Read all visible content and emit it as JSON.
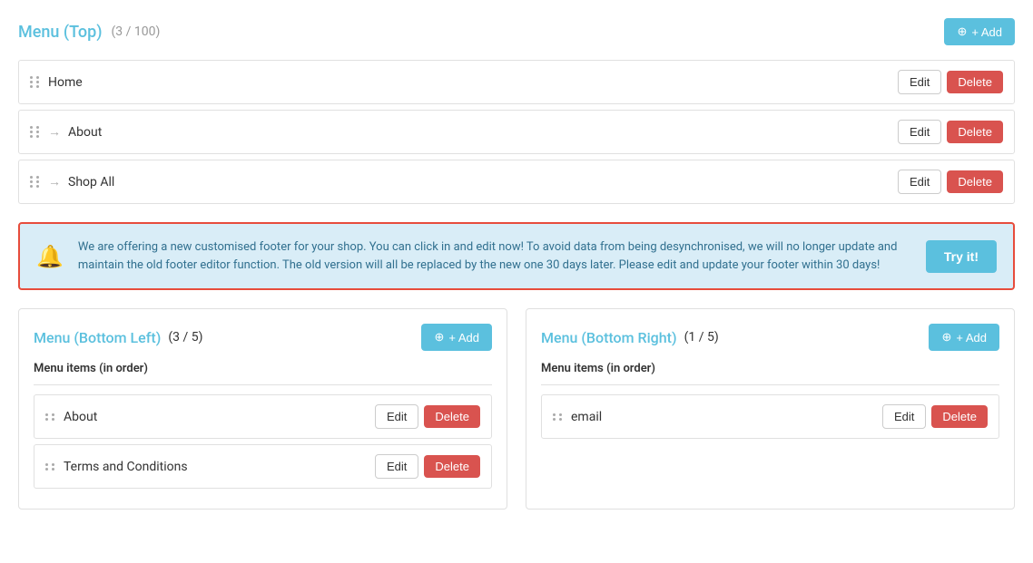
{
  "top_menu": {
    "title": "Menu (Top)",
    "count": "(3 / 100)",
    "add_label": "+ Add",
    "items": [
      {
        "label": "Home",
        "has_arrow": false
      },
      {
        "label": "About",
        "has_arrow": true
      },
      {
        "label": "Shop All",
        "has_arrow": true
      }
    ],
    "edit_label": "Edit",
    "delete_label": "Delete"
  },
  "alert": {
    "text": "We are offering a new customised footer for your shop. You can click in and edit now! To avoid data from being desynchronised, we will no longer update and maintain the old footer editor function. The old version will all be replaced by the new one 30 days later. Please edit and update your footer within 30 days!",
    "try_label": "Try it!"
  },
  "bottom_left": {
    "title": "Menu (Bottom Left)",
    "count": "(3 / 5)",
    "add_label": "+ Add",
    "menu_items_label": "Menu items (in order)",
    "items": [
      {
        "label": "About"
      },
      {
        "label": "Terms and Conditions"
      }
    ],
    "edit_label": "Edit",
    "delete_label": "Delete"
  },
  "bottom_right": {
    "title": "Menu (Bottom Right)",
    "count": "(1 / 5)",
    "add_label": "+ Add",
    "menu_items_label": "Menu items (in order)",
    "items": [
      {
        "label": "email"
      }
    ],
    "edit_label": "Edit",
    "delete_label": "Delete"
  }
}
